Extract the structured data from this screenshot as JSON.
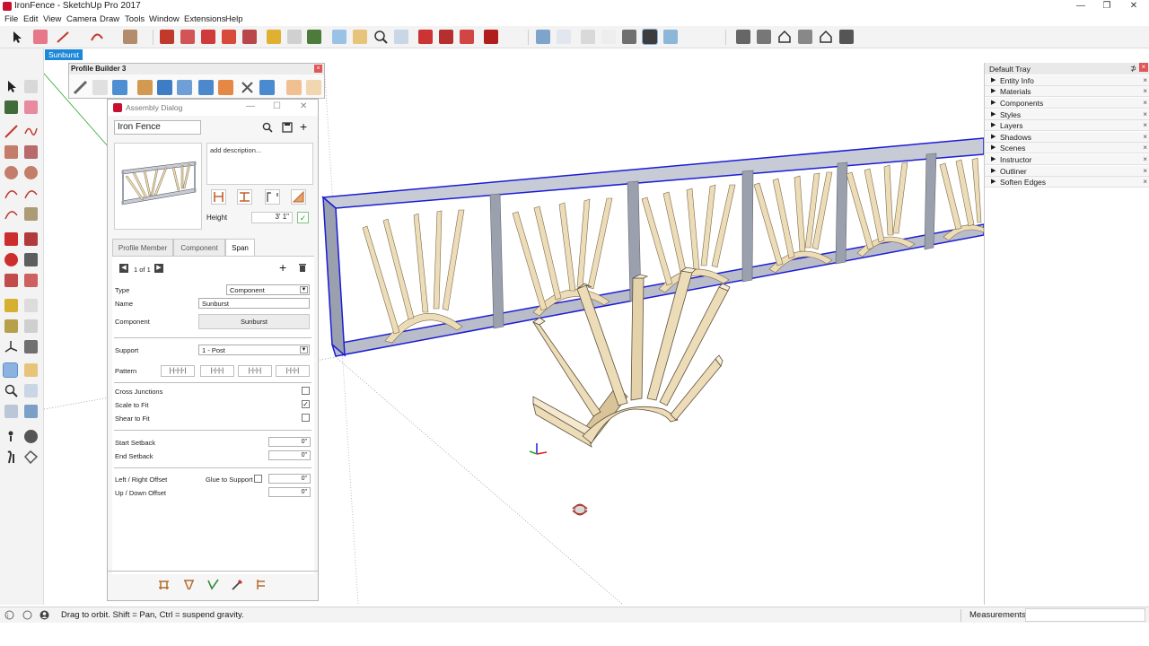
{
  "window": {
    "title": "IronFence - SketchUp Pro 2017",
    "minimize": "—",
    "maximize": "❐",
    "close": "✕"
  },
  "menu": [
    "File",
    "Edit",
    "View",
    "Camera",
    "Draw",
    "Tools",
    "Window",
    "Extensions",
    "Help"
  ],
  "scene_tab": "Sunburst",
  "profile_builder": {
    "title": "Profile Builder 3",
    "close": "×"
  },
  "assembly": {
    "title": "Assembly Dialog",
    "win_min": "—",
    "win_max": "☐",
    "win_close": "✕",
    "name": "Iron Fence",
    "description": "add description...",
    "height_label": "Height",
    "height_value": "3' 1\"",
    "check": "✓",
    "tabs": [
      "Profile Member",
      "Component",
      "Span"
    ],
    "span": {
      "counter": "1 of 1",
      "add": "+",
      "type_label": "Type",
      "type_value": "Component",
      "name_label": "Name",
      "name_value": "Sunburst",
      "component_label": "Component",
      "component_button": "Sunburst",
      "support_label": "Support",
      "support_value": "1 - Post",
      "pattern_label": "Pattern",
      "patterns": [
        "|-|-|-|-|",
        "|-|-|-|",
        "|-|-|-|",
        "|-|-|-|"
      ],
      "cross_junctions": "Cross Junctions",
      "scale_to_fit": "Scale to Fit",
      "shear_to_fit": "Shear to Fit",
      "checkmark": "✓",
      "start_setback": "Start Setback",
      "end_setback": "End Setback",
      "lr_offset": "Left / Right Offset",
      "glue_to_support": "Glue to Support",
      "ud_offset": "Up / Down Offset",
      "zero": "0\""
    }
  },
  "tray": {
    "title": "Default Tray",
    "pin": "⊅",
    "close": "×",
    "items": [
      "Entity Info",
      "Materials",
      "Components",
      "Styles",
      "Layers",
      "Shadows",
      "Scenes",
      "Instructor",
      "Outliner",
      "Soften Edges"
    ]
  },
  "status": {
    "text": "Drag to orbit. Shift = Pan, Ctrl = suspend gravity.",
    "measurements": "Measurements"
  },
  "colors": {
    "accent": "#1d88d8",
    "fence_edge": "#1c1cd6",
    "wood": "#ecdcb8",
    "post": "#b9bdc9"
  }
}
